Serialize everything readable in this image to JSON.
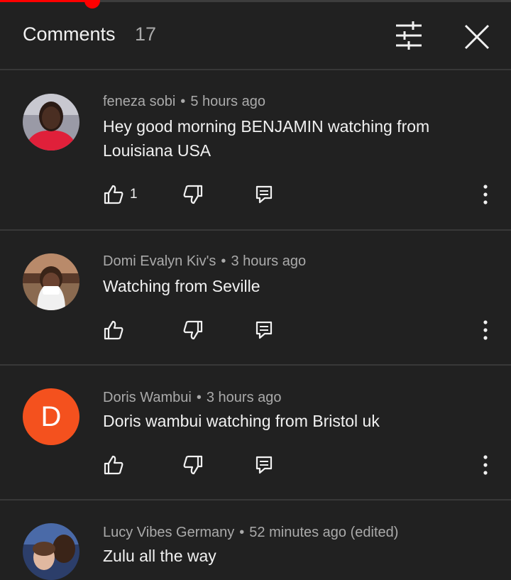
{
  "video_progress": {
    "played_fraction": 0.18
  },
  "header": {
    "title": "Comments",
    "count": "17",
    "filter_icon": "sort-filter-icon",
    "close_icon": "close-icon"
  },
  "comments": [
    {
      "author": "feneza sobi",
      "time": "5 hours ago",
      "text": "Hey good morning BENJAMIN watching from Louisiana USA",
      "likes": "1",
      "avatar": "photo"
    },
    {
      "author": "Domi Evalyn Kiv's",
      "time": "3 hours ago",
      "text": "Watching from Seville",
      "likes": "",
      "avatar": "photo"
    },
    {
      "author": "Doris Wambui",
      "time": "3 hours ago",
      "text": "Doris wambui watching from Bristol uk",
      "likes": "",
      "avatar": "letter",
      "avatar_letter": "D",
      "avatar_color": "#f4511e"
    },
    {
      "author": "Lucy Vibes Germany",
      "time": "52 minutes ago (edited)",
      "text": "Zulu all the way",
      "likes": "",
      "avatar": "photo"
    }
  ],
  "icons": {
    "like": "thumbs-up-icon",
    "dislike": "thumbs-down-icon",
    "reply": "reply-icon",
    "more": "more-vertical-icon"
  },
  "colors": {
    "background": "#212121",
    "divider": "#383838",
    "secondary_text": "#aaaaaa",
    "progress": "#ff0000"
  }
}
